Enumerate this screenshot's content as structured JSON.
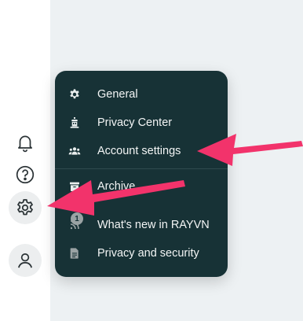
{
  "sidebar": {
    "icons": [
      {
        "name": "bell-icon"
      },
      {
        "name": "help-icon"
      },
      {
        "name": "gear-icon"
      },
      {
        "name": "user-icon"
      }
    ]
  },
  "menu": {
    "items": [
      {
        "label": "General",
        "icon": "gear-icon"
      },
      {
        "label": "Privacy Center",
        "icon": "building-icon"
      },
      {
        "label": "Account settings",
        "icon": "people-icon"
      },
      {
        "label": "Archive",
        "icon": "archive-icon"
      },
      {
        "label": "What's new in RAYVN",
        "icon": "feed-icon",
        "badge": "1"
      },
      {
        "label": "Privacy and security",
        "icon": "document-icon"
      }
    ]
  },
  "colors": {
    "menu_bg": "#173236",
    "arrow": "#f2336b",
    "pane_bg": "#edf1f3"
  }
}
